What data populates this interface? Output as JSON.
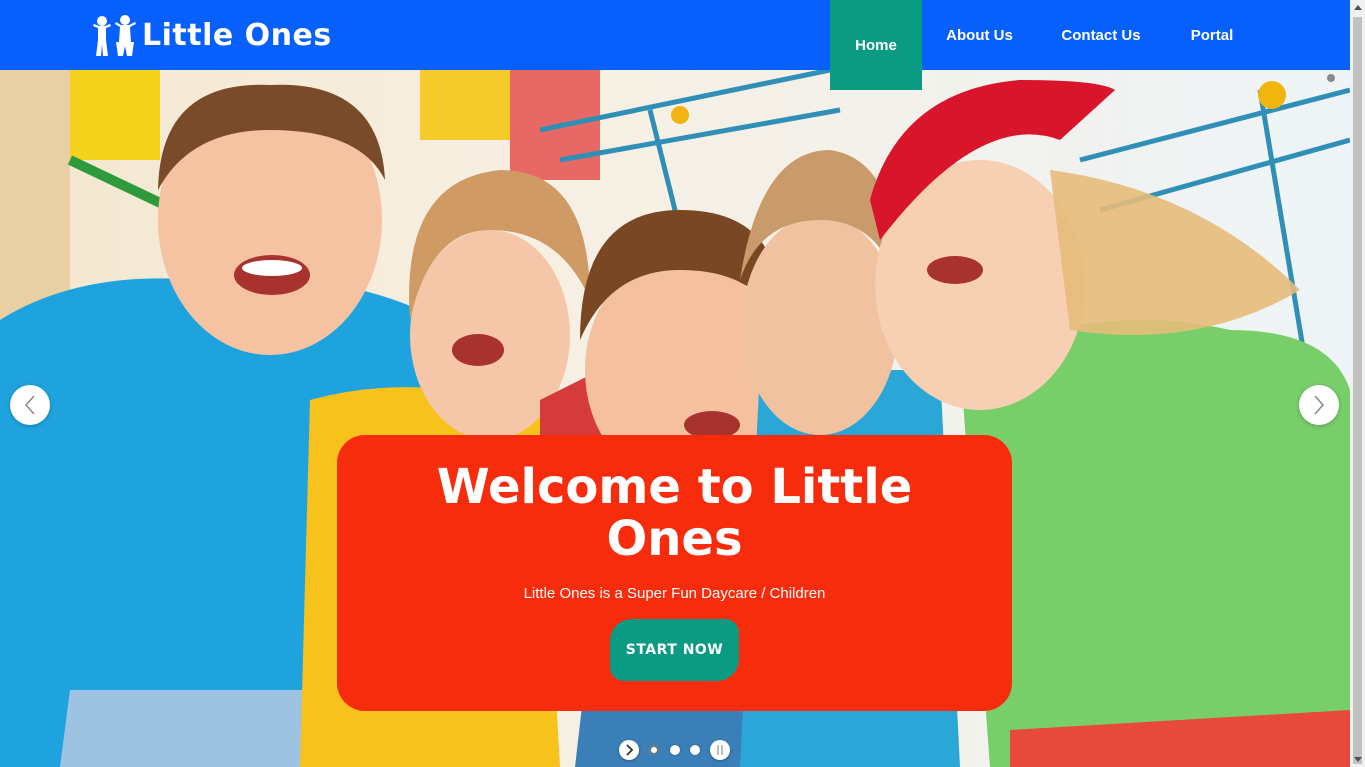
{
  "brand": {
    "name": "Little Ones",
    "logo_icon": "children-figures-icon",
    "color": "#0760fb"
  },
  "nav": {
    "items": [
      {
        "label": "Home",
        "active": true
      },
      {
        "label": "About Us",
        "active": false
      },
      {
        "label": "Contact Us",
        "active": false
      },
      {
        "label": "Portal",
        "active": false
      }
    ],
    "active_color": "#0a9b82"
  },
  "hero": {
    "image": "group-of-smiling-children-photo",
    "title": "Welcome to Little Ones",
    "subtitle": "Little Ones is a Super Fun Daycare / Children",
    "cta_label": "START NOW",
    "box_color": "#f72c0d",
    "prev_icon": "chevron-left-icon",
    "next_icon": "chevron-right-icon",
    "slides": {
      "count": 3,
      "active_index": 0,
      "play_icon": "play-icon",
      "pause_icon": "pause-icon"
    }
  }
}
